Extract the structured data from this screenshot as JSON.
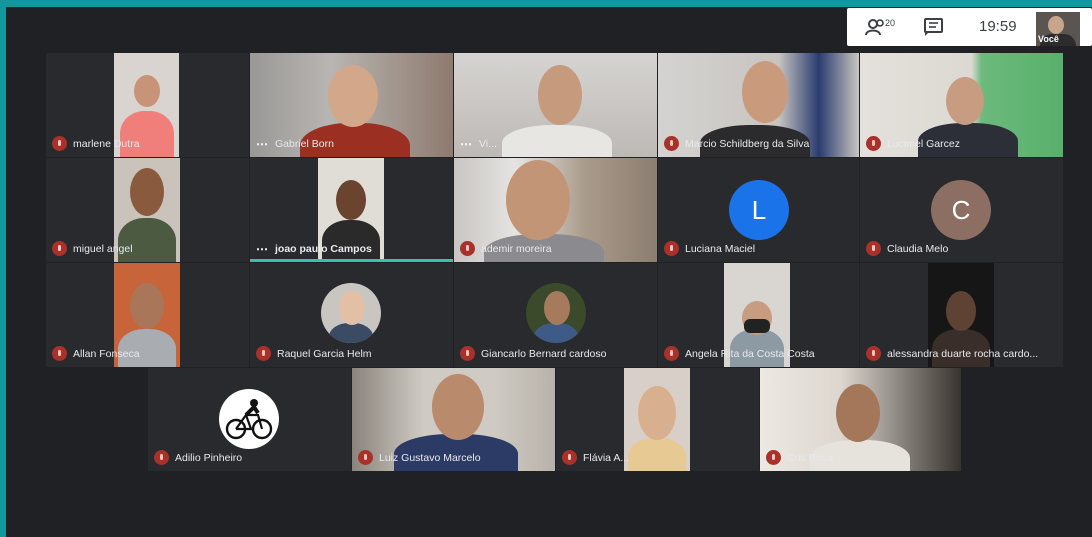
{
  "toolbar": {
    "participant_count": "20",
    "clock": "19:59",
    "self_label": "Você"
  },
  "participants": [
    {
      "name": "marlene Dutra"
    },
    {
      "name": "Gabriel Born"
    },
    {
      "name": "Vi..."
    },
    {
      "name": "Marcio Schildberg da Silva"
    },
    {
      "name": "Lucimel Garcez"
    },
    {
      "name": "miguel angel"
    },
    {
      "name": "joao paulo Campos"
    },
    {
      "name": "ademir moreira"
    },
    {
      "name": "Luciana Maciel",
      "initial": "L"
    },
    {
      "name": "Claudia Melo",
      "initial": "C"
    },
    {
      "name": "Allan Fonseca"
    },
    {
      "name": "Raquel Garcia Helm"
    },
    {
      "name": "Giancarlo Bernard cardoso"
    },
    {
      "name": "Angela Rita da Costa Costa"
    },
    {
      "name": "alessandra duarte rocha cardo..."
    },
    {
      "name": "Adilio Pinheiro"
    },
    {
      "name": "Luiz Gustavo Marcelo"
    },
    {
      "name": "Flávia A..."
    },
    {
      "name": "Cris Rosa"
    }
  ],
  "colors": {
    "frame": "#13979e",
    "background": "#202124",
    "tile": "#3c4043",
    "avatar_blue": "#1a73e8",
    "avatar_brown": "#8d6e63",
    "speaking_bar": "#3fbfa7"
  }
}
